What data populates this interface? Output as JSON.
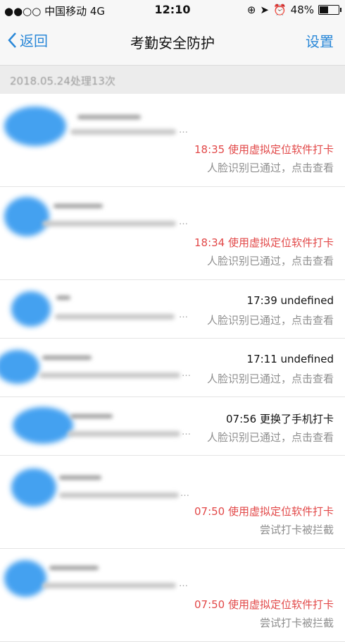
{
  "status_bar": {
    "carrier": "●●○○ 中国移动  4G",
    "time": "12:10",
    "battery": "48%",
    "battery_level": 0.48
  },
  "nav": {
    "back_label": "返回",
    "title": "考勤安全防护",
    "settings_label": "设置"
  },
  "section": {
    "date_label": "2018.05.24处理13次"
  },
  "records": [
    {
      "time_event": "18:35 使用虚拟定位软件打卡",
      "status": "人脸识别已通过，点击查看",
      "alert": true
    },
    {
      "time_event": "18:34 使用虚拟定位软件打卡",
      "status": "人脸识别已通过，点击查看",
      "alert": true
    },
    {
      "time_event": "17:39 undefined",
      "status": "人脸识别已通过，点击查看",
      "alert": false
    },
    {
      "time_event": "17:11 undefined",
      "status": "人脸识别已通过，点击查看",
      "alert": false
    },
    {
      "time_event": "07:56 更换了手机打卡",
      "status": "人脸识别已通过，点击查看",
      "alert": false
    },
    {
      "time_event": "07:50 使用虚拟定位软件打卡",
      "status": "尝试打卡被拦截",
      "alert": true
    },
    {
      "time_event": "07:50 使用虚拟定位软件打卡",
      "status": "尝试打卡被拦截",
      "alert": true
    }
  ]
}
